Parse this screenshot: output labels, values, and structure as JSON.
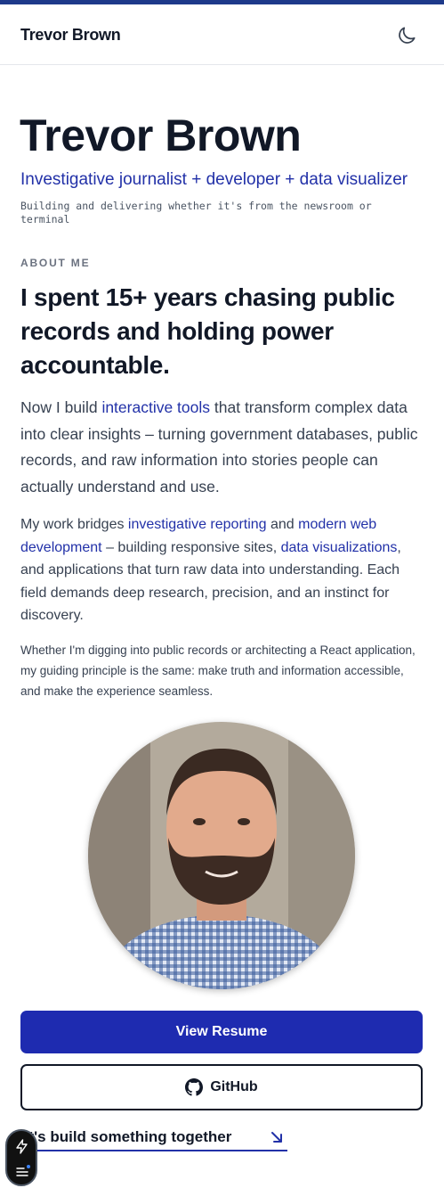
{
  "header": {
    "brand": "Trevor Brown"
  },
  "hero": {
    "name": "Trevor Brown",
    "tagline": "Investigative journalist + developer + data visualizer",
    "subtagline": "Building and delivering whether it's from the newsroom or terminal"
  },
  "about": {
    "label": "ABOUT ME",
    "heading": "I spent 15+ years chasing public records and holding power accountable.",
    "p1": {
      "before": "Now I build ",
      "link": "interactive tools",
      "after": " that transform complex data into clear insights – turning government databases, public records, and raw information into stories people can actually understand and use."
    },
    "p2": {
      "before": "My work bridges ",
      "link1": "investigative reporting",
      "mid1": " and ",
      "link2": "modern web development",
      "mid2": " – building responsive sites, ",
      "link3": "data visualizations",
      "after": ", and applications that turn raw data into understanding. Each field demands deep research, precision, and an instinct for discovery."
    },
    "p3": "Whether I'm digging into public records or architecting a React application, my guiding principle is the same: make truth and information accessible, and make the experience seamless."
  },
  "actions": {
    "resume": "View Resume",
    "github": "GitHub",
    "cta": "Let's build something together",
    "cta_visible": "et's build something together"
  },
  "icons": {
    "theme": "moon-icon",
    "github": "github-icon",
    "cta": "arrow-down-right-icon",
    "widget": [
      "lightning-icon",
      "menu-icon"
    ]
  },
  "colors": {
    "accent": "#1e2bb0",
    "link": "#2231a8",
    "top_bar": "#1e3a8a",
    "text_dark": "#111827"
  }
}
